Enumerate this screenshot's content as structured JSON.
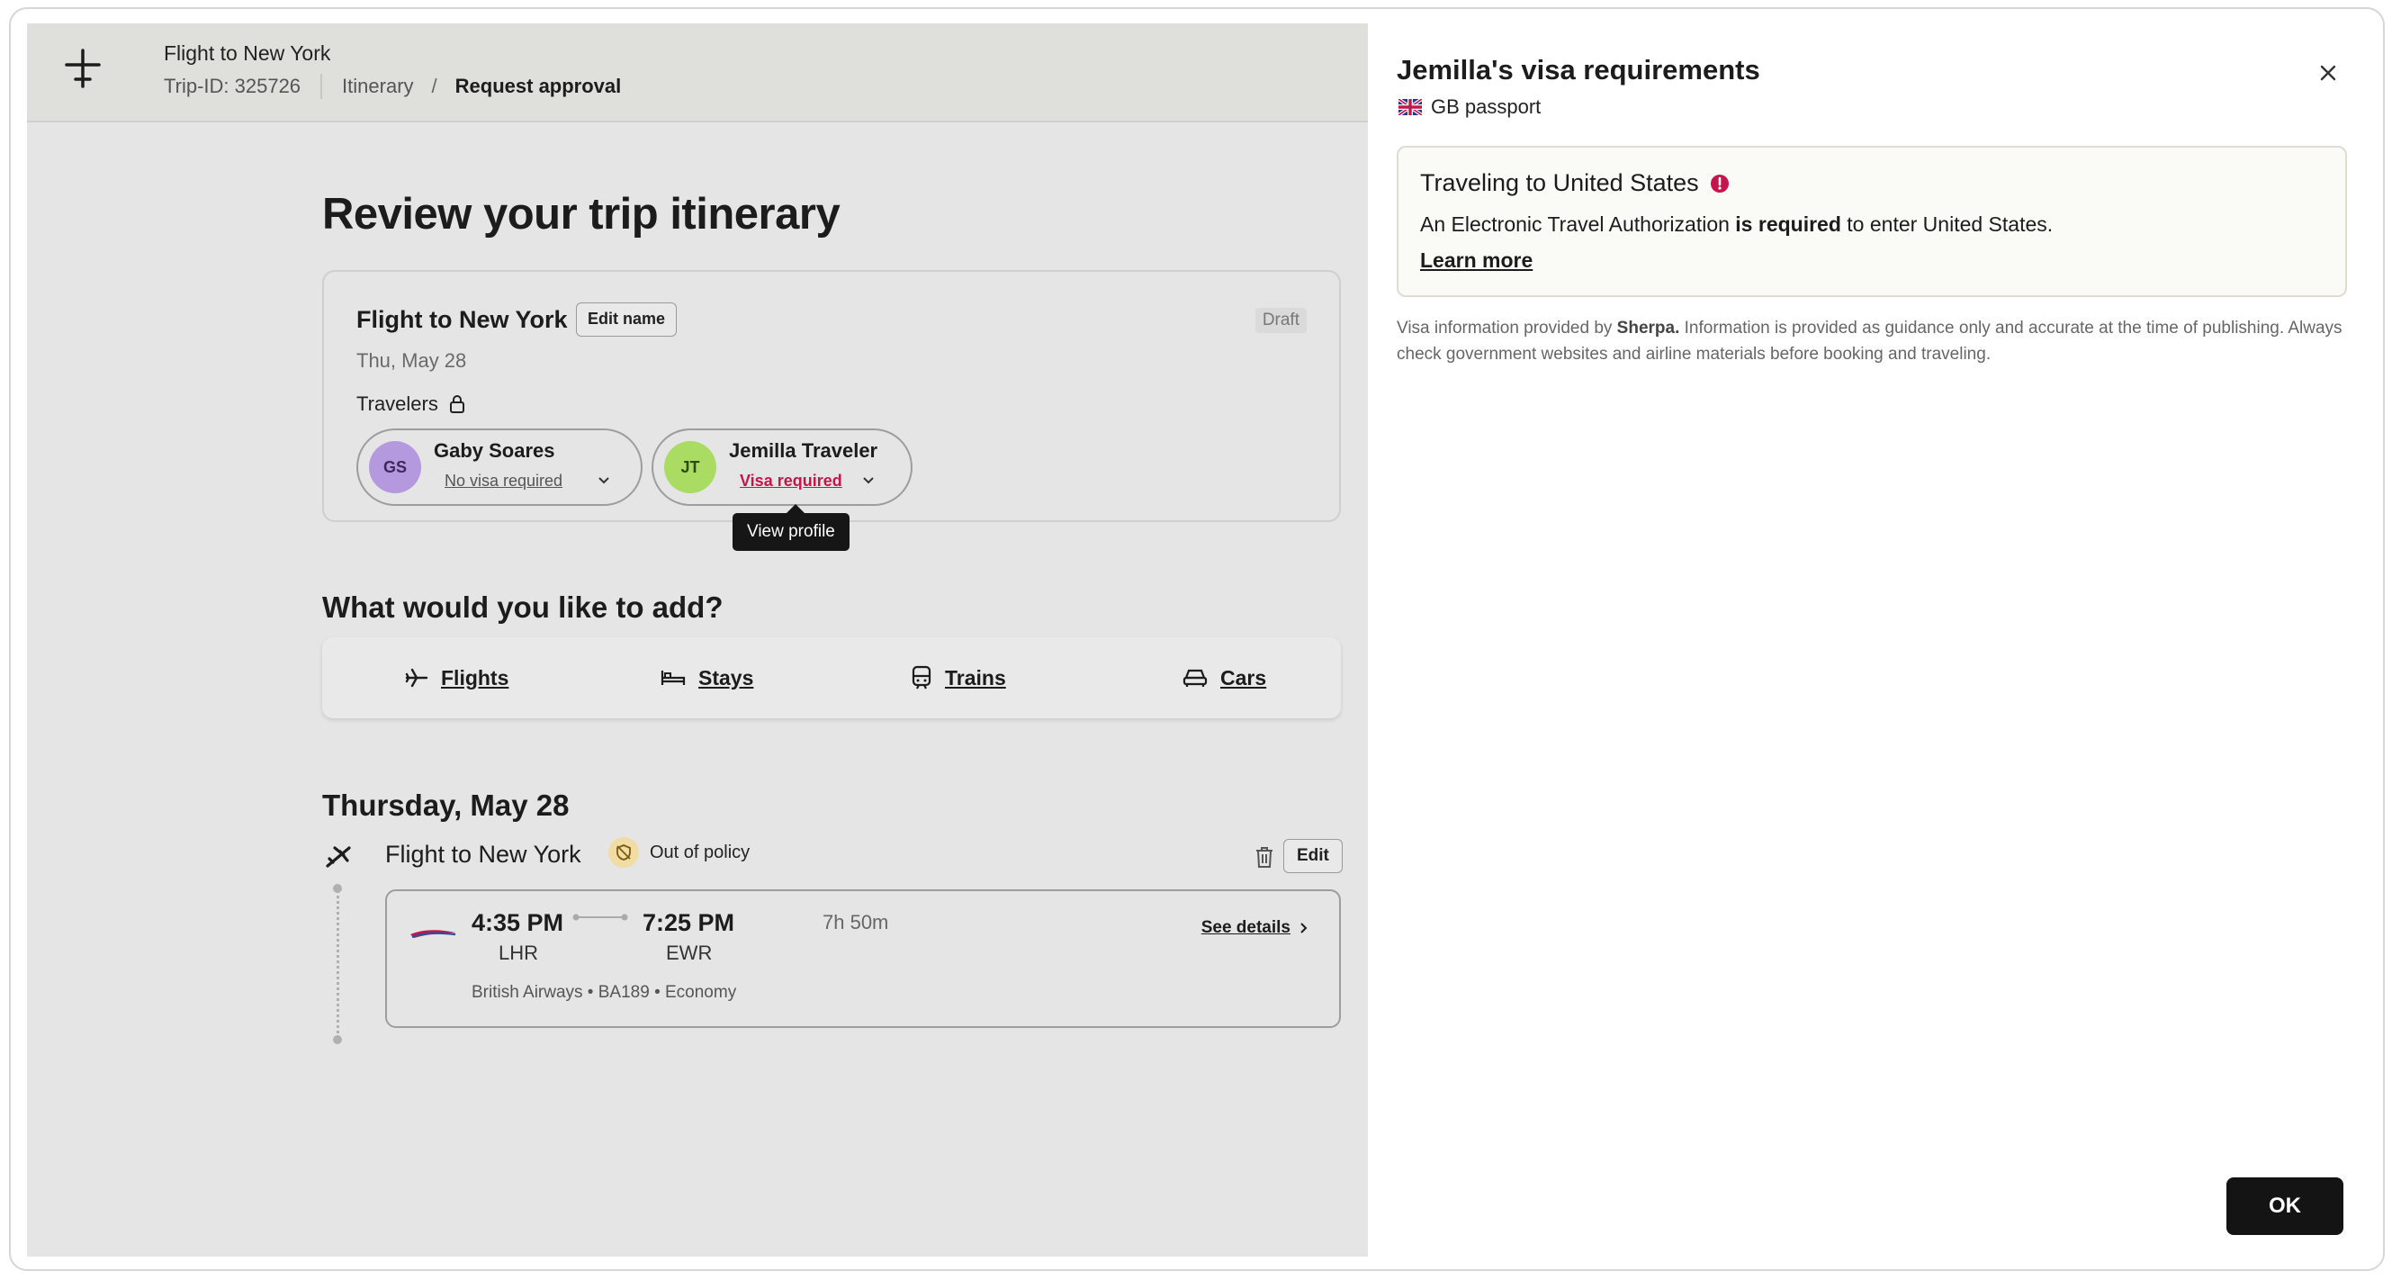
{
  "app": {
    "title": "Flight to New York",
    "trip_id": "Trip-ID: 325726",
    "breadcrumb": {
      "itinerary": "Itinerary",
      "separator": "/",
      "current": "Request approval"
    }
  },
  "review": {
    "heading": "Review your trip itinerary",
    "trip_name": "Flight to New York",
    "edit_name_label": "Edit name",
    "status": "Draft",
    "date": "Thu, May 28",
    "travelers_label": "Travelers",
    "travelers": [
      {
        "initials": "GS",
        "name": "Gaby Soares",
        "visa_status": "No visa required"
      },
      {
        "initials": "JT",
        "name": "Jemilla Traveler",
        "visa_status": "Visa required"
      }
    ],
    "tooltip": "View profile"
  },
  "add": {
    "heading": "What would you like to add?",
    "items": [
      {
        "label": "Flights",
        "icon": "plane-icon"
      },
      {
        "label": "Stays",
        "icon": "bed-icon"
      },
      {
        "label": "Trains",
        "icon": "train-icon"
      },
      {
        "label": "Cars",
        "icon": "car-icon"
      }
    ]
  },
  "day": {
    "heading": "Thursday, May 28",
    "segment_title": "Flight to New York",
    "policy_badge": "Out of policy",
    "edit_label": "Edit",
    "flight": {
      "departure_time": "4:35 PM",
      "departure_code": "LHR",
      "arrival_time": "7:25 PM",
      "arrival_code": "EWR",
      "duration": "7h 50m",
      "details_label": "See details",
      "meta": "British Airways • BA189 • Economy"
    }
  },
  "drawer": {
    "title": "Jemilla's visa requirements",
    "passport": "GB passport",
    "box_title": "Traveling to United States",
    "box_body_pre": "An Electronic Travel Authorization ",
    "box_body_bold": "is required",
    "box_body_post": " to enter United States.",
    "learn_more": "Learn more",
    "note_pre": "Visa information provided by ",
    "note_provider": "Sherpa.",
    "note_post": " Information is provided as guidance only and accurate at the time of publishing. Always check government websites and airline materials before booking and traveling.",
    "ok_label": "OK"
  },
  "colors": {
    "accent_red": "#c4164a",
    "avatar_gs": "#b599df",
    "avatar_jt": "#aadb63",
    "policy_badge_bg": "#f0dca4",
    "primary_button": "#141414"
  }
}
